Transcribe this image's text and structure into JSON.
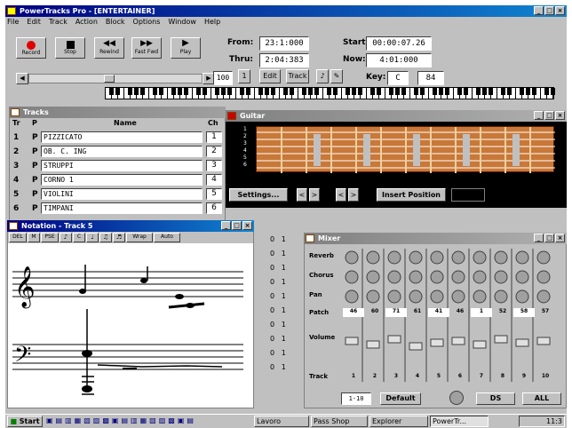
{
  "app": {
    "title": "PowerTracks Pro - [ENTERTAINER]"
  },
  "menu": [
    "File",
    "Edit",
    "Track",
    "Action",
    "Block",
    "Options",
    "Window",
    "Help"
  ],
  "transport": [
    {
      "label": "Record",
      "icon": "record-icon"
    },
    {
      "label": "Stop",
      "icon": "stop-icon"
    },
    {
      "label": "Rewind",
      "icon": "rewind-icon"
    },
    {
      "label": "Fast Fwd",
      "icon": "fast-forward-icon"
    },
    {
      "label": "Play",
      "icon": "play-icon"
    }
  ],
  "position": {
    "from_label": "From:",
    "from": "23:1:000",
    "thru_label": "Thru:",
    "thru": "2:04:383",
    "start_label": "Start:",
    "start": "00:00:07.26",
    "now_label": "Now:",
    "now": "4:01:000",
    "key_label": "Key:",
    "key": "C",
    "tempo": "84"
  },
  "toolbar2": {
    "zoom": "100",
    "number": "1",
    "btn_a": "Edit",
    "btn_b": "Track"
  },
  "tracks": {
    "title": "Tracks",
    "headers": {
      "tr": "Tr",
      "p": "P",
      "name": "Name",
      "ch": "Ch"
    },
    "rows": [
      {
        "tr": "1",
        "p": "P",
        "name": "PIZZICATO",
        "ch": "1"
      },
      {
        "tr": "2",
        "p": "P",
        "name": "OB. C. ING",
        "ch": "2"
      },
      {
        "tr": "3",
        "p": "P",
        "name": "STRUPPI",
        "ch": "3"
      },
      {
        "tr": "4",
        "p": "P",
        "name": "CORNO 1",
        "ch": "4"
      },
      {
        "tr": "5",
        "p": "P",
        "name": "VIOLINI",
        "ch": "5"
      },
      {
        "tr": "6",
        "p": "P",
        "name": "TIMPANI",
        "ch": "6"
      }
    ]
  },
  "guitar": {
    "title": "Guitar",
    "settings_label": "Settings...",
    "insert_label": "Insert Position",
    "nav": [
      "<",
      ">",
      "<",
      ">"
    ],
    "string_numbers": [
      "1",
      "2",
      "3",
      "4",
      "5",
      "6"
    ]
  },
  "notation": {
    "title": "Notation - Track 5",
    "toolbar": [
      "DEL",
      "M",
      "PSE",
      "",
      "C",
      "",
      "",
      "",
      "Wrap",
      "Auto"
    ]
  },
  "mixer": {
    "title": "Mixer",
    "rows": [
      "Reverb",
      "Chorus",
      "Pan",
      "Patch",
      "Volume",
      "Track"
    ],
    "patches": [
      "46",
      "60",
      "71",
      "61",
      "41",
      "46",
      "1",
      "52",
      "58",
      "57"
    ],
    "tracks": [
      "1",
      "2",
      "3",
      "4",
      "5",
      "6",
      "7",
      "8",
      "9",
      "10"
    ],
    "preset": "1-10",
    "default_label": "Default",
    "btn_a": "DS",
    "btn_b": "ALL"
  },
  "track_column": [
    "0",
    "0",
    "0",
    "0",
    "0",
    "0",
    "0",
    "0",
    "0",
    "0",
    "0"
  ],
  "taskbar": {
    "start": "Start",
    "items": [
      "Lavoro",
      "Pass Shop",
      "Explorer",
      "PowerTr..."
    ],
    "clock": "11:3"
  }
}
